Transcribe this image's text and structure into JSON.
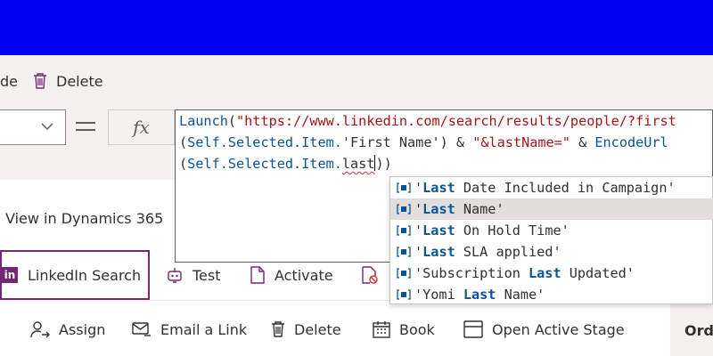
{
  "toolbar": {
    "hide_partial": "de",
    "delete_label": "Delete"
  },
  "formula_bar": {
    "property_value": "",
    "equals": "=",
    "fx": "fx",
    "line1": {
      "fn": "Launch",
      "open": "(",
      "url": "\"https://www.linkedin.com/search/results/people/?first"
    },
    "line2": {
      "open": "(",
      "self": "Self.Selected.Item.",
      "field": "'First Name'",
      "close": ")",
      "amp1": " & ",
      "str": "\"&lastName=\"",
      "amp2": " & ",
      "fn": "EncodeUrl"
    },
    "line3": {
      "open": "(",
      "self": "Self.Selected.Item.",
      "typed": "last",
      "close": "))"
    }
  },
  "left_pane": {
    "view_label": "View in Dynamics 365"
  },
  "tabs": {
    "linkedin": {
      "logo": "in",
      "label": "LinkedIn Search"
    },
    "test": "Test",
    "activate": "Activate"
  },
  "actions": {
    "partial": "",
    "assign": "Assign",
    "email_link": "Email a Link",
    "delete": "Delete",
    "book": "Book",
    "open_stage": "Open Active Stage"
  },
  "right_label": "Ord",
  "suggestions": [
    {
      "pre": "'",
      "match": "Last",
      "post": " Date Included in Campaign'",
      "selected": false
    },
    {
      "pre": "'",
      "match": "Last",
      "post": " Name'",
      "selected": true
    },
    {
      "pre": "'",
      "match": "Last",
      "post": " On Hold Time'",
      "selected": false
    },
    {
      "pre": "'",
      "match": "Last",
      "post": " SLA applied'",
      "selected": false
    },
    {
      "pre": "'Subscription ",
      "match": "Last",
      "post": " Updated'",
      "selected": false
    },
    {
      "pre": "'Yomi ",
      "match": "Last",
      "post": " Name'",
      "selected": false
    }
  ],
  "colors": {
    "brand_bar": "#0000f5",
    "accent_purple": "#742774",
    "code_keyword": "#0b5394",
    "code_string": "#a31515"
  }
}
